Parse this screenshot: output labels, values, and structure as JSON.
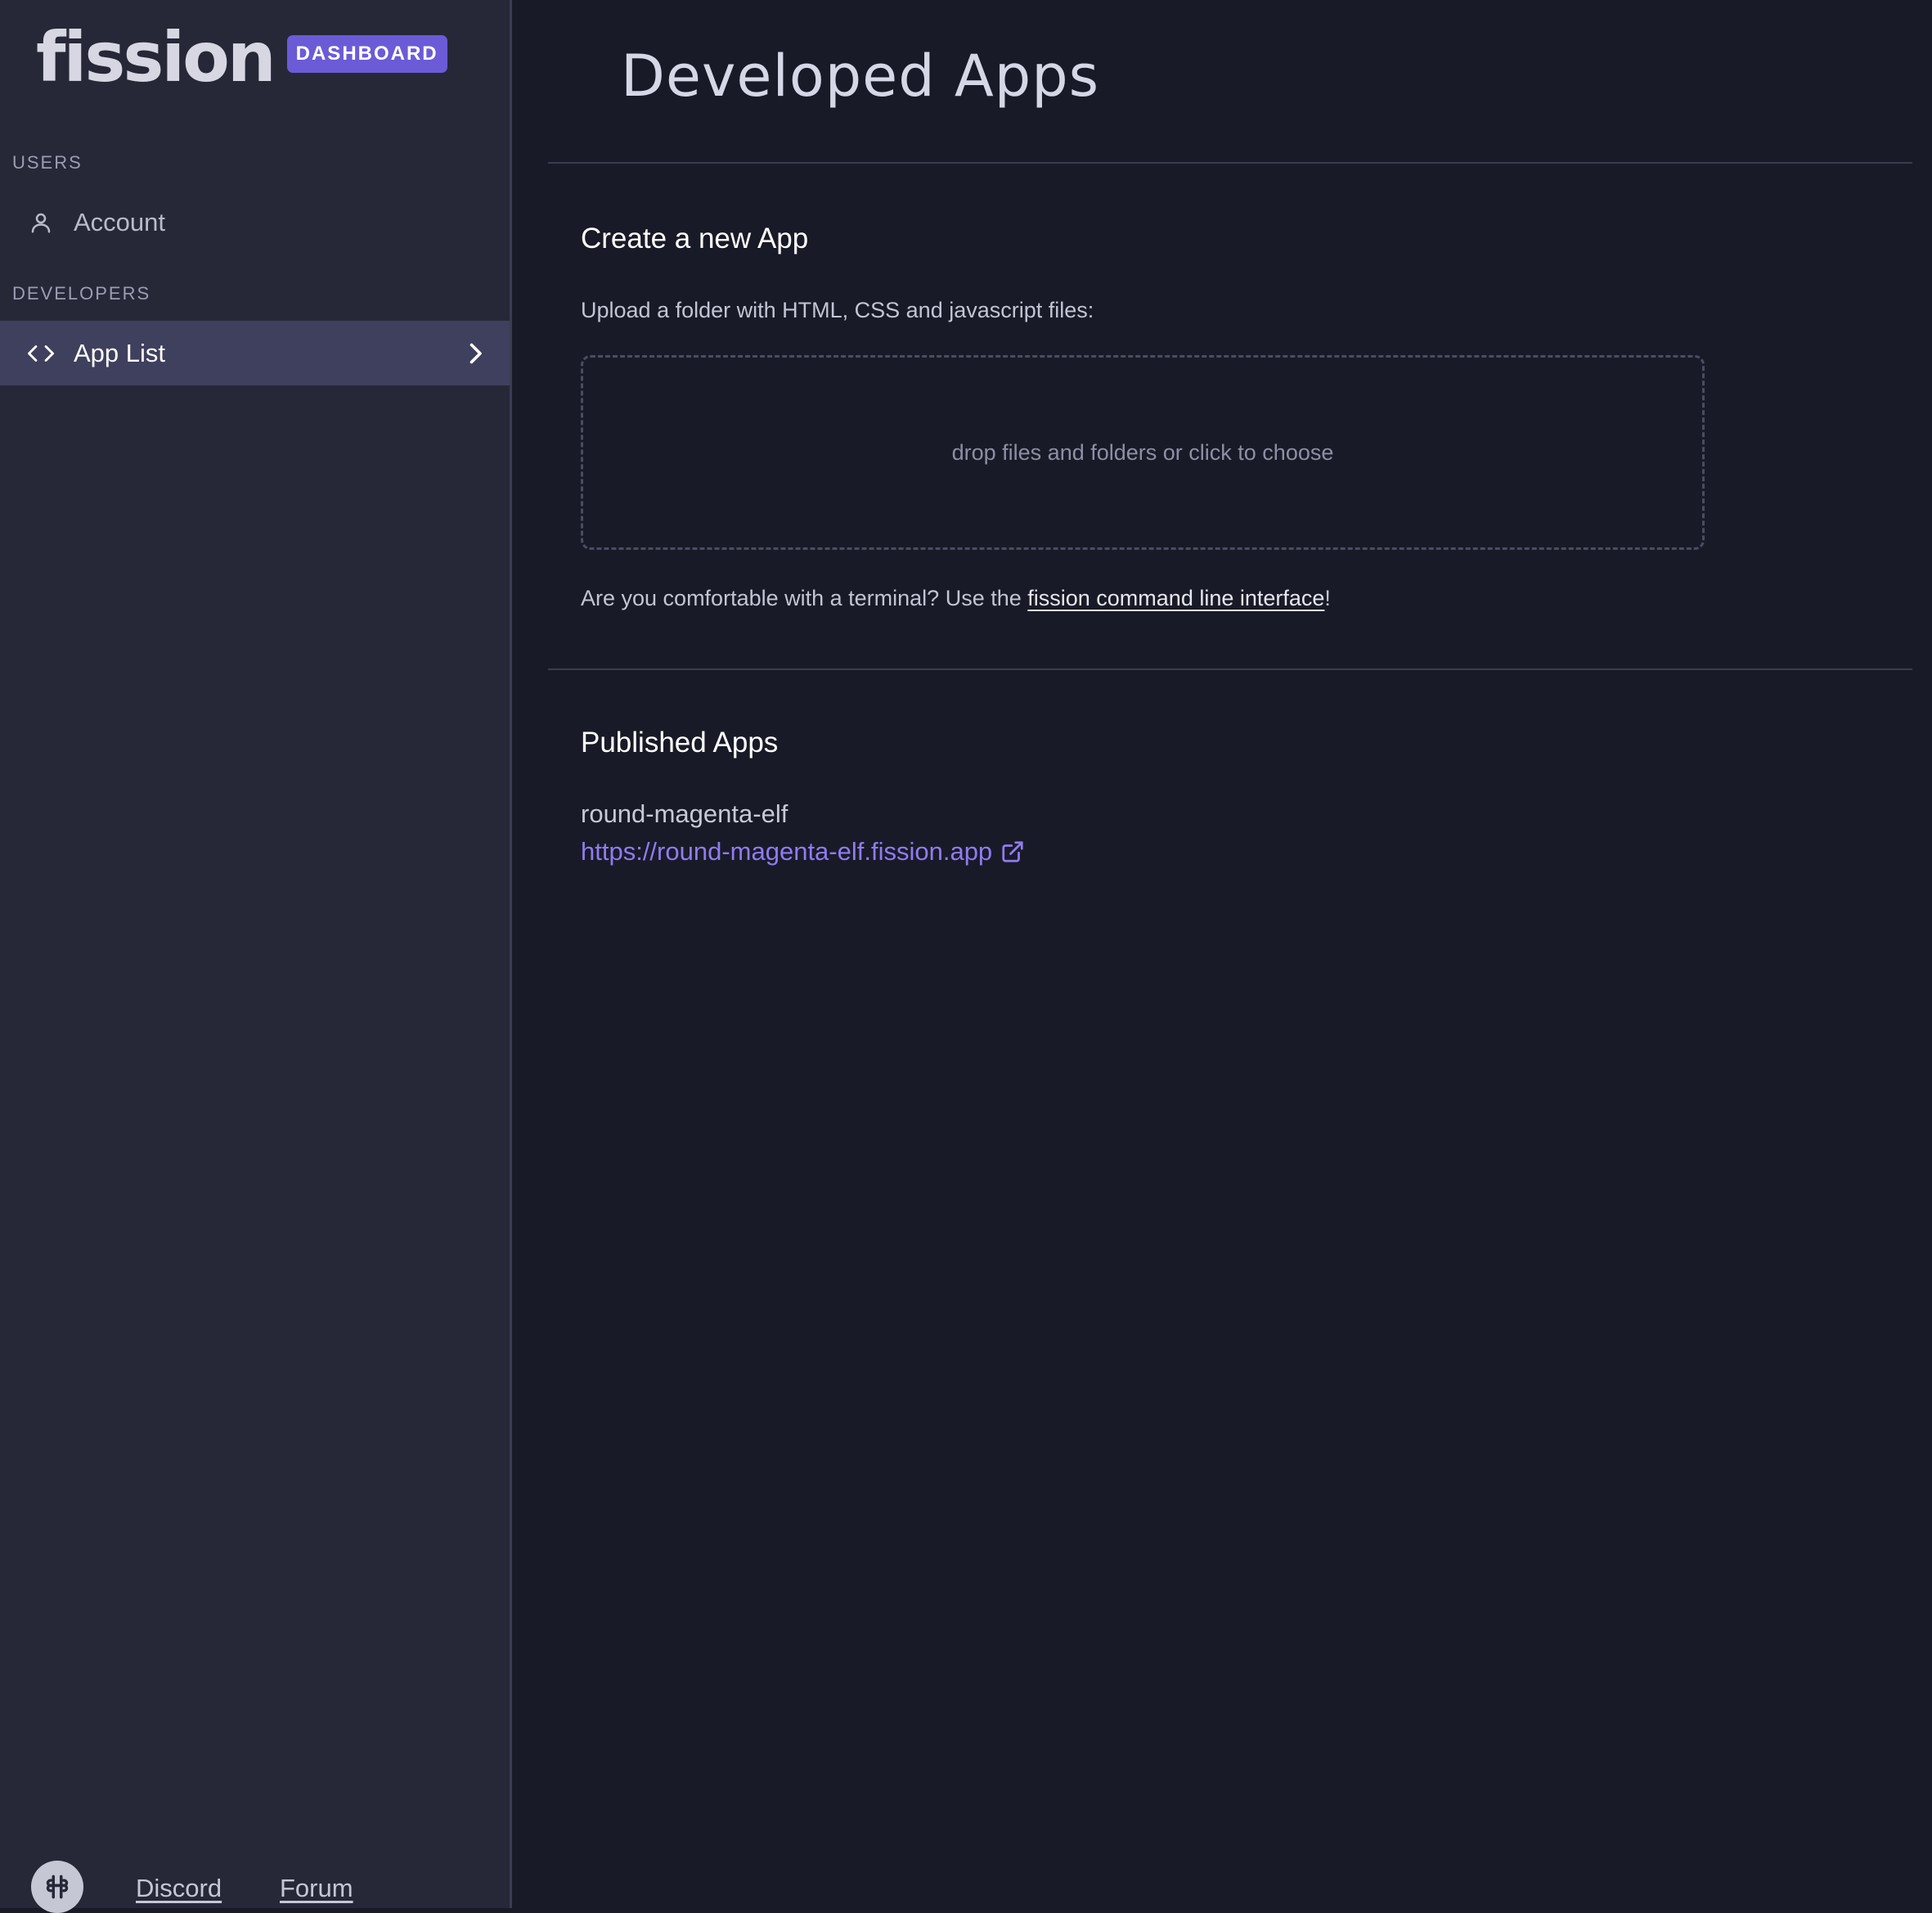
{
  "brand": {
    "logo_text": "fission",
    "badge": "DASHBOARD"
  },
  "sidebar": {
    "sections": [
      {
        "label": "USERS",
        "items": [
          {
            "label": "Account",
            "icon": "user-icon",
            "active": false
          }
        ]
      },
      {
        "label": "DEVELOPERS",
        "items": [
          {
            "label": "App List",
            "icon": "code-icon",
            "active": true
          }
        ]
      }
    ],
    "footer": {
      "logo_icon": "fission-logo-icon",
      "links": [
        "Discord",
        "Forum"
      ]
    }
  },
  "main": {
    "title": "Developed Apps",
    "create": {
      "heading": "Create a new App",
      "instructions": "Upload a folder with HTML, CSS and javascript files:",
      "dropzone_text": "drop files and folders or click to choose",
      "cli_prefix": "Are you comfortable with a terminal? Use the ",
      "cli_link": "fission command line interface",
      "cli_suffix": "!"
    },
    "published": {
      "heading": "Published Apps",
      "apps": [
        {
          "name": "round-magenta-elf",
          "url": "https://round-magenta-elf.fission.app",
          "link_icon": "external-link-icon"
        }
      ]
    }
  },
  "colors": {
    "background": "#191a27",
    "sidebar": "#262838",
    "accent": "#6b5bd6",
    "link": "#8e7cf0",
    "active_item": "#3f405d"
  }
}
